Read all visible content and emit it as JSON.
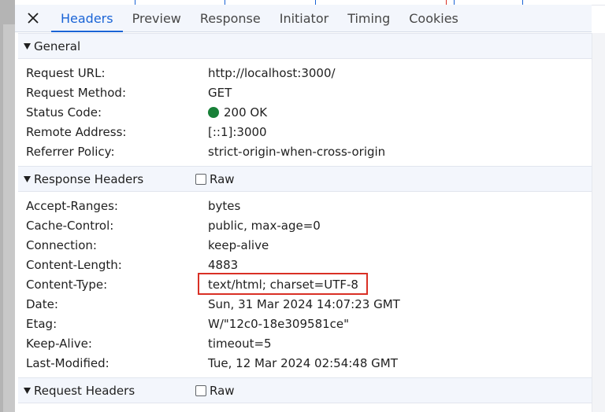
{
  "colors": {
    "accent": "#1a64d6",
    "status_ok": "#188038",
    "highlight_border": "#d93025",
    "section_bg": "#f3f6fc"
  },
  "tabs": [
    {
      "label": "Headers",
      "active": true
    },
    {
      "label": "Preview",
      "active": false
    },
    {
      "label": "Response",
      "active": false
    },
    {
      "label": "Initiator",
      "active": false
    },
    {
      "label": "Timing",
      "active": false
    },
    {
      "label": "Cookies",
      "active": false
    }
  ],
  "general": {
    "title": "General",
    "rows": [
      {
        "key": "Request URL:",
        "value": "http://localhost:3000/"
      },
      {
        "key": "Request Method:",
        "value": "GET"
      },
      {
        "key": "Status Code:",
        "value": "200 OK",
        "icon": "status-ok-dot"
      },
      {
        "key": "Remote Address:",
        "value": "[::1]:3000"
      },
      {
        "key": "Referrer Policy:",
        "value": "strict-origin-when-cross-origin"
      }
    ]
  },
  "response_headers": {
    "title": "Response Headers",
    "raw_label": "Raw",
    "raw_checked": false,
    "rows": [
      {
        "key": "Accept-Ranges:",
        "value": "bytes"
      },
      {
        "key": "Cache-Control:",
        "value": "public, max-age=0"
      },
      {
        "key": "Connection:",
        "value": "keep-alive"
      },
      {
        "key": "Content-Length:",
        "value": "4883"
      },
      {
        "key": "Content-Type:",
        "value": "text/html; charset=UTF-8",
        "highlighted": true
      },
      {
        "key": "Date:",
        "value": "Sun, 31 Mar 2024 14:07:23 GMT"
      },
      {
        "key": "Etag:",
        "value": "W/\"12c0-18e309581ce\""
      },
      {
        "key": "Keep-Alive:",
        "value": "timeout=5"
      },
      {
        "key": "Last-Modified:",
        "value": "Tue, 12 Mar 2024 02:54:48 GMT"
      }
    ]
  },
  "request_headers": {
    "title": "Request Headers",
    "raw_label": "Raw",
    "raw_checked": false
  }
}
